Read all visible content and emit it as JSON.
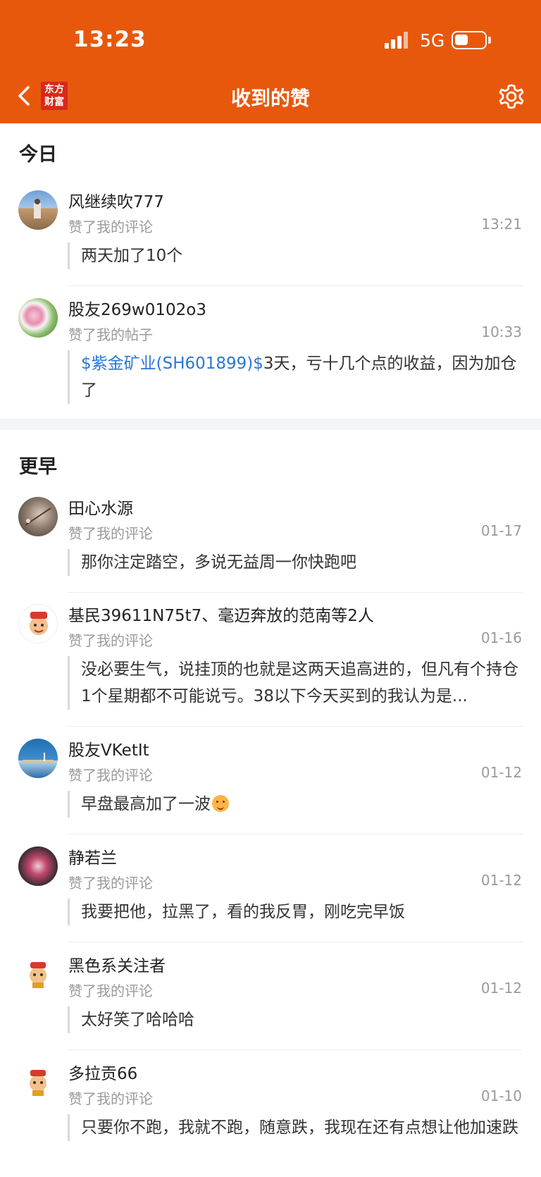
{
  "status_bar": {
    "time": "13:23",
    "network": "5G"
  },
  "header": {
    "logo_line1": "东方",
    "logo_line2": "财富",
    "title": "收到的赞"
  },
  "sections": [
    {
      "title": "今日",
      "items": [
        {
          "name": "风继续吹777",
          "action": "赞了我的评论",
          "time": "13:21",
          "text": "两天加了10个"
        },
        {
          "name": "股友269w0102o3",
          "action": "赞了我的帖子",
          "time": "10:33",
          "stock": "$紫金矿业(SH601899)$",
          "text": "3天，亏十几个点的收益，因为加仓了"
        }
      ]
    },
    {
      "title": "更早",
      "items": [
        {
          "name": "田心水源",
          "action": "赞了我的评论",
          "time": "01-17",
          "text": "那你注定踏空，多说无益周一你快跑吧"
        },
        {
          "name": "基民39611N75t7、毫迈奔放的范南等2人",
          "action": "赞了我的评论",
          "time": "01-16",
          "text": "没必要生气，说挂顶的也就是这两天追高进的，但凡有个持仓1个星期都不可能说亏。38以下今天买到的我认为是..."
        },
        {
          "name": "股友VKetIt",
          "action": "赞了我的评论",
          "time": "01-12",
          "text": "早盘最高加了一波"
        },
        {
          "name": "静若兰",
          "action": "赞了我的评论",
          "time": "01-12",
          "text": "我要把他，拉黑了，看的我反胃，刚吃完早饭"
        },
        {
          "name": "黑色系关注者",
          "action": "赞了我的评论",
          "time": "01-12",
          "text": "太好笑了哈哈哈"
        },
        {
          "name": "多拉贡66",
          "action": "赞了我的评论",
          "time": "01-10",
          "text": "只要你不跑，我就不跑，随意跌，我现在还有点想让他加速跌"
        }
      ]
    }
  ]
}
